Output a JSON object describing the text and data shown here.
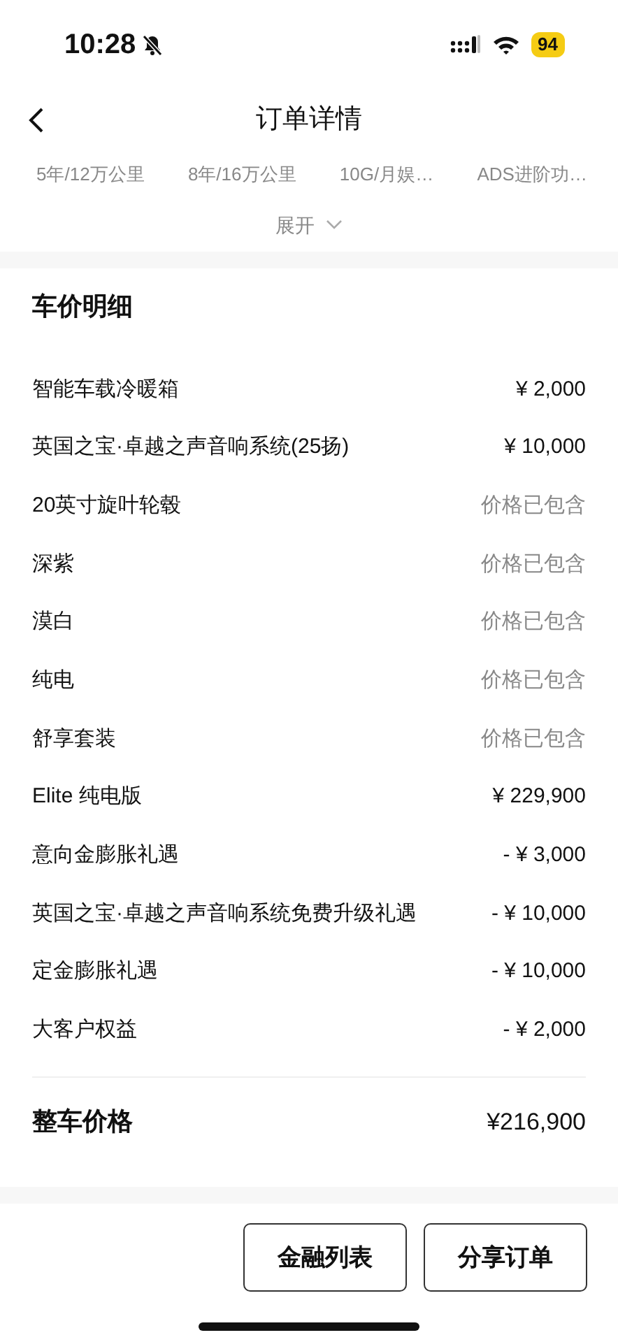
{
  "status_bar": {
    "time": "10:28",
    "battery": "94"
  },
  "header": {
    "title": "订单详情"
  },
  "features": [
    "5年/12万公里",
    "8年/16万公里",
    "10G/月娱…",
    "ADS进阶功…"
  ],
  "expand": {
    "label": "展开",
    "expanded": false
  },
  "price_detail": {
    "title": "车价明细",
    "rows": [
      {
        "name": "智能车载冷暖箱",
        "value": "¥ 2,000",
        "kind": "price"
      },
      {
        "name": "英国之宝·卓越之声音响系统(25扬)",
        "value": "¥ 10,000",
        "kind": "price"
      },
      {
        "name": "20英寸旋叶轮毂",
        "value": "价格已包含",
        "kind": "included"
      },
      {
        "name": "深紫",
        "value": "价格已包含",
        "kind": "included"
      },
      {
        "name": "漠白",
        "value": "价格已包含",
        "kind": "included"
      },
      {
        "name": "纯电",
        "value": "价格已包含",
        "kind": "included"
      },
      {
        "name": "舒享套装",
        "value": "价格已包含",
        "kind": "included"
      },
      {
        "name": "Elite 纯电版",
        "value": "¥ 229,900",
        "kind": "price"
      },
      {
        "name": "意向金膨胀礼遇",
        "value": "- ¥ 3,000",
        "kind": "price"
      },
      {
        "name": "英国之宝·卓越之声音响系统免费升级礼遇",
        "value": "- ¥ 10,000",
        "kind": "price"
      },
      {
        "name": "定金膨胀礼遇",
        "value": "- ¥ 10,000",
        "kind": "price"
      },
      {
        "name": "大客户权益",
        "value": "- ¥ 2,000",
        "kind": "price"
      }
    ],
    "total_label": "整车价格",
    "total_value": "¥216,900"
  },
  "buttons": [
    "金融列表",
    "分享订单"
  ]
}
